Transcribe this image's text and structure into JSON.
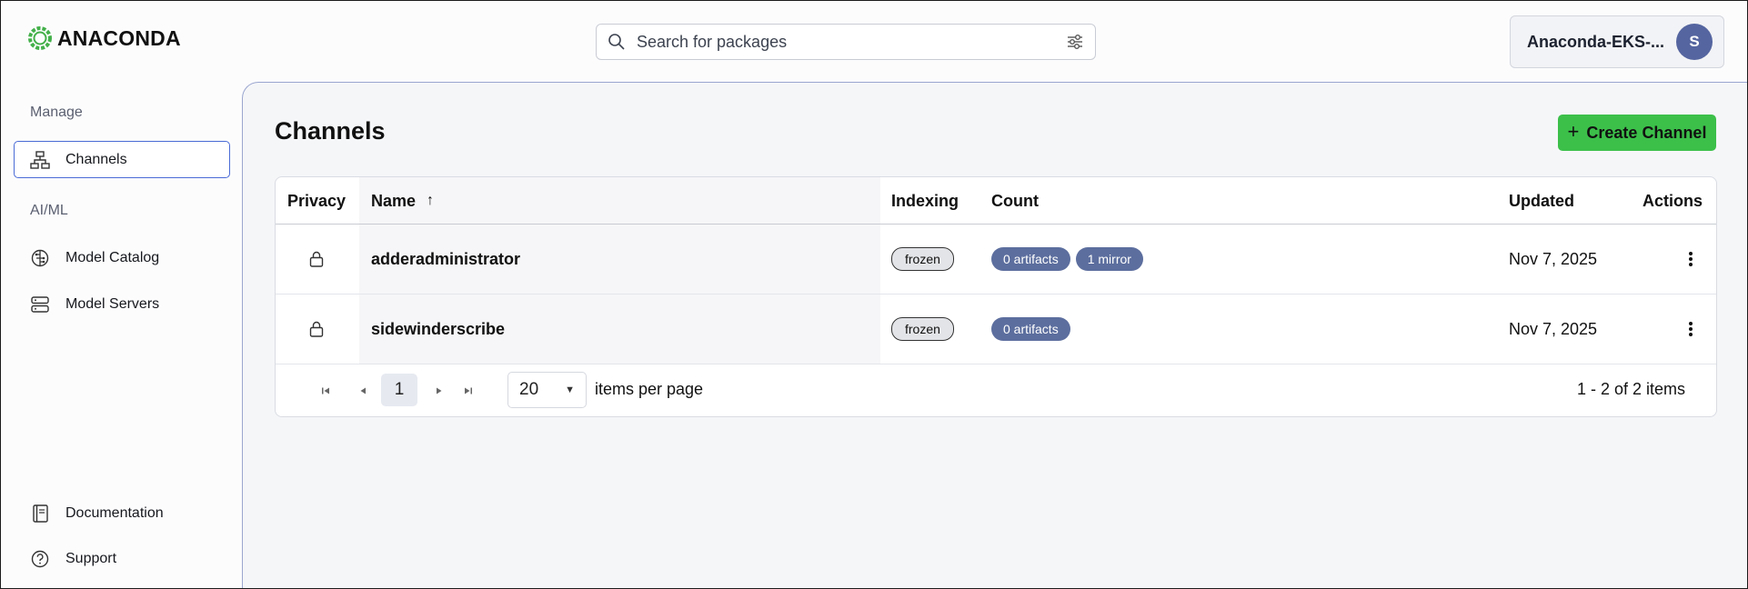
{
  "header": {
    "brand": "ANACONDA",
    "search": {
      "placeholder": "Search for packages"
    },
    "account": {
      "name": "Anaconda-EKS-...",
      "avatar_initial": "S"
    }
  },
  "sidebar": {
    "sections": [
      {
        "heading": "Manage",
        "items": [
          {
            "label": "Channels",
            "icon": "channels-icon",
            "active": true
          }
        ]
      },
      {
        "heading": "AI/ML",
        "items": [
          {
            "label": "Model Catalog",
            "icon": "model-catalog-icon"
          },
          {
            "label": "Model Servers",
            "icon": "model-servers-icon"
          }
        ]
      }
    ],
    "footer": [
      {
        "label": "Documentation",
        "icon": "book-icon"
      },
      {
        "label": "Support",
        "icon": "help-circle-icon"
      }
    ]
  },
  "main": {
    "title": "Channels",
    "create_button": "Create Channel",
    "table": {
      "columns": [
        "Privacy",
        "Name",
        "Indexing",
        "Count",
        "Updated",
        "Actions"
      ],
      "sort_indicator": "↑",
      "rows": [
        {
          "privacy": "lock-icon",
          "name": "adderadministrator",
          "indexing": "frozen",
          "badges": [
            "0 artifacts",
            "1 mirror"
          ],
          "updated": "Nov 7, 2025"
        },
        {
          "privacy": "lock-icon",
          "name": "sidewinderscribe",
          "indexing": "frozen",
          "badges": [
            "0 artifacts"
          ],
          "updated": "Nov 7, 2025"
        }
      ]
    },
    "pagination": {
      "current_page": "1",
      "page_size": "20",
      "page_size_label": "items per page",
      "range_text": "1 - 2 of 2 items"
    }
  },
  "colors": {
    "accent_green": "#3cc04a",
    "badge_blue": "#5c6e9e",
    "avatar": "#5565a0",
    "active_border": "#4a6bd6"
  }
}
